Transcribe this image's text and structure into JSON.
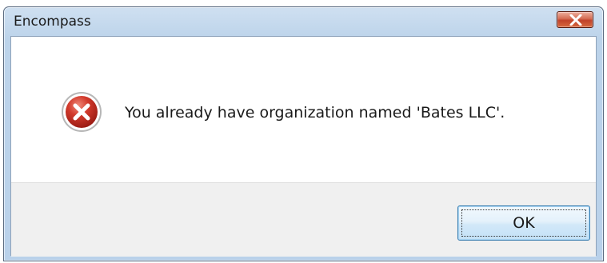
{
  "dialog": {
    "title": "Encompass",
    "message": "You already have organization named 'Bates LLC'.",
    "icon": "error-icon",
    "buttons": {
      "ok_label": "OK"
    }
  },
  "colors": {
    "title_bar": "#bcd3ea",
    "close_button": "#c0422a",
    "error_icon": "#c8322a",
    "ok_button_border": "#3c7fb1",
    "footer": "#f0f0f0"
  }
}
